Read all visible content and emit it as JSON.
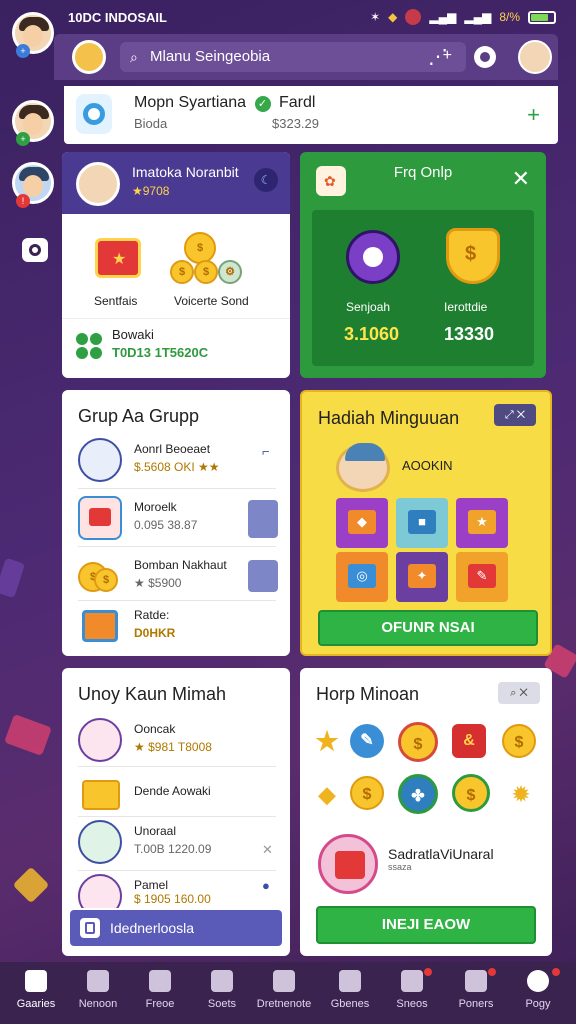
{
  "status_bar": {
    "time": "10DC INDOSAIL",
    "battery": "8/%"
  },
  "topbar": {
    "search_placeholder": "Mlanu Seingeobia",
    "plus": "+"
  },
  "profile": {
    "name": "Mopn Syartiana",
    "badge_text": "Fardl",
    "sub_left": "Bioda",
    "sub_right": "$323.29"
  },
  "user_card": {
    "name": "Imatoka Noranbit",
    "stars": "★9708",
    "reward_left_label": "Sentfais",
    "reward_right_label": "Voicerte Sond",
    "bottom_title": "Bowaki",
    "bottom_value": "T0D13 1T5620C"
  },
  "group_card": {
    "title": "Frq Onlp",
    "left_label": "Senjoah",
    "left_value": "3.1060",
    "right_label": "Ierottdie",
    "right_value": "13330"
  },
  "grup_card": {
    "title": "Grup Aa Grupp",
    "items": [
      {
        "title": "Aonrl Beoeaet",
        "value": "$.5608 OKI ★★"
      },
      {
        "title": "Moroelk",
        "value": "0.095 38.87"
      },
      {
        "title": "Bomban Nakhaut",
        "value": "★ $5900"
      },
      {
        "title": "Ratde:",
        "value": "D0HKR"
      }
    ]
  },
  "hadiah_card": {
    "title": "Hadiah Minguuan",
    "user": "AOOKIN",
    "button": "OFUNR NSAI"
  },
  "unoy_card": {
    "title": "Unoy Kaun Mimah",
    "items": [
      {
        "title": "Ooncak",
        "value": "★ $981 T8008"
      },
      {
        "title": "Dende Aowaki",
        "value": ""
      },
      {
        "title": "Unoraal",
        "value": "T.00B 1220.09"
      },
      {
        "title": "Pamel",
        "value": "$ 1905 160.00"
      }
    ],
    "footer": "Idednerloosla"
  },
  "shop_card": {
    "title": "Horp Minoan",
    "promo_title": "SadratlaViUnaral",
    "promo_sub": "ssaza",
    "button": "INEJI EAOW"
  },
  "bottom_nav": [
    {
      "label": "Gaaries"
    },
    {
      "label": "Nenoon"
    },
    {
      "label": "Freoe"
    },
    {
      "label": "Soets"
    },
    {
      "label": "Dretnenote"
    },
    {
      "label": "Gbenes"
    },
    {
      "label": "Sneos"
    },
    {
      "label": "Poners"
    },
    {
      "label": "Pogy"
    }
  ],
  "colors": {
    "background": "#4c2a73",
    "accent_green": "#2e9a3e",
    "accent_yellow": "#f8dc46",
    "header_purple": "#4a3a92"
  }
}
